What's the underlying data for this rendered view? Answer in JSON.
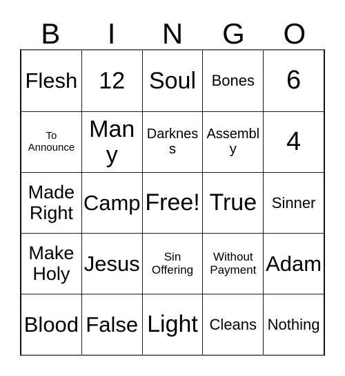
{
  "card": {
    "headers": [
      "B",
      "I",
      "N",
      "G",
      "O"
    ],
    "rows": [
      [
        {
          "text": "Flesh",
          "size": "fs-2xl"
        },
        {
          "text": "12",
          "size": "fs-3xl"
        },
        {
          "text": "Soul",
          "size": "fs-3xl"
        },
        {
          "text": "Bones",
          "size": "fs-lg"
        },
        {
          "text": "6",
          "size": "fs-4xl"
        }
      ],
      [
        {
          "text": "To Announce",
          "size": "fs-xs"
        },
        {
          "text": "Many",
          "size": "fs-3xl"
        },
        {
          "text": "Darkness",
          "size": "fs-md"
        },
        {
          "text": "Assembly",
          "size": "fs-md"
        },
        {
          "text": "4",
          "size": "fs-4xl"
        }
      ],
      [
        {
          "text": "Made Right",
          "size": "fs-xl"
        },
        {
          "text": "Camp",
          "size": "fs-2xl"
        },
        {
          "text": "Free!",
          "size": "fs-3xl"
        },
        {
          "text": "True",
          "size": "fs-3xl"
        },
        {
          "text": "Sinner",
          "size": "fs-lg"
        }
      ],
      [
        {
          "text": "Make Holy",
          "size": "fs-xl"
        },
        {
          "text": "Jesus",
          "size": "fs-2xl"
        },
        {
          "text": "Sin Offering",
          "size": "fs-sm"
        },
        {
          "text": "Without Payment",
          "size": "fs-sm"
        },
        {
          "text": "Adam",
          "size": "fs-2xl"
        }
      ],
      [
        {
          "text": "Blood",
          "size": "fs-2xl"
        },
        {
          "text": "False",
          "size": "fs-2xl"
        },
        {
          "text": "Light",
          "size": "fs-3xl"
        },
        {
          "text": "Cleans",
          "size": "fs-lg"
        },
        {
          "text": "Nothing",
          "size": "fs-lg"
        }
      ]
    ]
  }
}
